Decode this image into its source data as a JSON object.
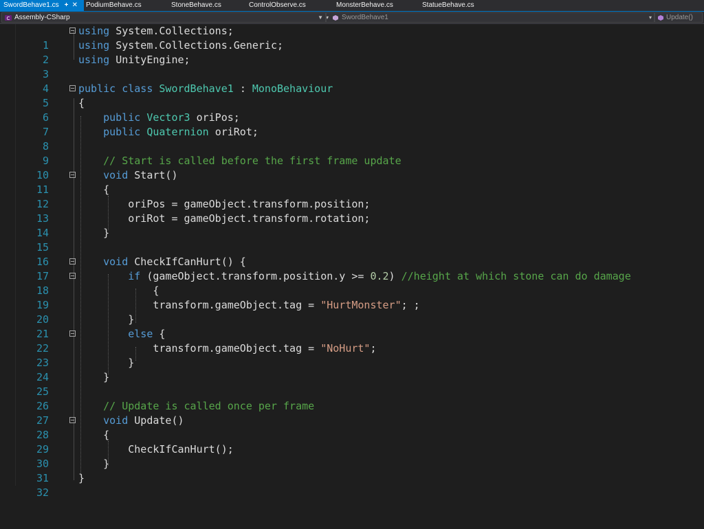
{
  "tabs": [
    {
      "label": "SwordBehave1.cs",
      "active": true
    },
    {
      "label": "PodiumBehave.cs"
    },
    {
      "label": "StoneBehave.cs"
    },
    {
      "label": "ControlObserve.cs"
    },
    {
      "label": "MonsterBehave.cs"
    },
    {
      "label": "StatueBehave.cs"
    }
  ],
  "navbar": {
    "project": "Assembly-CSharp",
    "class": "SwordBehave1",
    "member": "Update()"
  },
  "colors": {
    "keyword": "#569cd6",
    "type": "#4ec9b0",
    "comment": "#57a64a",
    "string": "#d69d85",
    "line_number": "#2b91af",
    "accent": "#007acc"
  },
  "code_lines": [
    {
      "n": "1",
      "text": "using System.Collections;"
    },
    {
      "n": "2",
      "text": "using System.Collections.Generic;"
    },
    {
      "n": "3",
      "text": "using UnityEngine;"
    },
    {
      "n": "4",
      "text": ""
    },
    {
      "n": "5",
      "text": "public class SwordBehave1 : MonoBehaviour"
    },
    {
      "n": "6",
      "text": "{"
    },
    {
      "n": "7",
      "text": "    public Vector3 oriPos;"
    },
    {
      "n": "8",
      "text": "    public Quaternion oriRot;"
    },
    {
      "n": "9",
      "text": ""
    },
    {
      "n": "10",
      "text": "    // Start is called before the first frame update"
    },
    {
      "n": "11",
      "text": "    void Start()"
    },
    {
      "n": "12",
      "text": "    {"
    },
    {
      "n": "13",
      "text": "        oriPos = gameObject.transform.position;"
    },
    {
      "n": "14",
      "text": "        oriRot = gameObject.transform.rotation;"
    },
    {
      "n": "15",
      "text": "    }"
    },
    {
      "n": "16",
      "text": ""
    },
    {
      "n": "17",
      "text": "    void CheckIfCanHurt() {"
    },
    {
      "n": "18",
      "text": "        if (gameObject.transform.position.y >= 0.2) //height at which stone can do damage"
    },
    {
      "n": "19",
      "text": "            {"
    },
    {
      "n": "20",
      "text": "            transform.gameObject.tag = \"HurtMonster\"; ;"
    },
    {
      "n": "21",
      "text": "        }"
    },
    {
      "n": "22",
      "text": "        else {"
    },
    {
      "n": "23",
      "text": "            transform.gameObject.tag = \"NoHurt\";"
    },
    {
      "n": "24",
      "text": "        }"
    },
    {
      "n": "25",
      "text": "    }"
    },
    {
      "n": "26",
      "text": ""
    },
    {
      "n": "27",
      "text": "    // Update is called once per frame"
    },
    {
      "n": "28",
      "text": "    void Update()"
    },
    {
      "n": "29",
      "text": "    {"
    },
    {
      "n": "30",
      "text": "        CheckIfCanHurt();"
    },
    {
      "n": "31",
      "text": "    }"
    },
    {
      "n": "32",
      "text": "}"
    }
  ]
}
